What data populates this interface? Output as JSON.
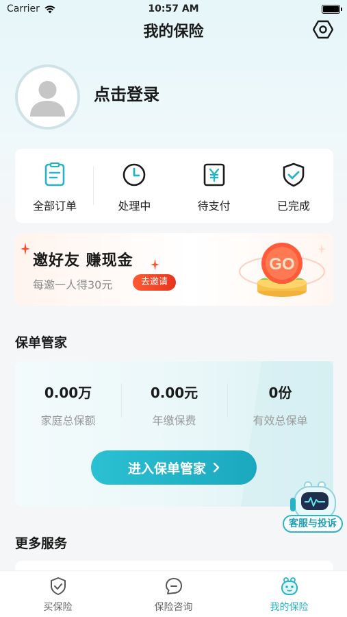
{
  "status_bar": {
    "carrier": "Carrier",
    "time": "10:57 AM"
  },
  "header": {
    "title": "我的保险"
  },
  "profile": {
    "login_text": "点击登录"
  },
  "orders": [
    {
      "label": "全部订单",
      "icon": "order-list-icon"
    },
    {
      "label": "处理中",
      "icon": "clock-icon"
    },
    {
      "label": "待支付",
      "icon": "yuan-payment-icon"
    },
    {
      "label": "已完成",
      "icon": "shield-check-icon"
    }
  ],
  "invite": {
    "title": "邀好友  赚现金",
    "subtitle": "每邀一人得30元",
    "button": "去邀请",
    "coin_text": "GO"
  },
  "policy_section": {
    "title": "保单管家",
    "stats": [
      {
        "value": "0.00万",
        "caption": "家庭总保额"
      },
      {
        "value": "0.00元",
        "caption": "年缴保费"
      },
      {
        "value": "0份",
        "caption": "有效总保单"
      }
    ],
    "enter_button": "进入保单管家"
  },
  "more_section": {
    "title": "更多服务"
  },
  "service": {
    "badge": "客服与投诉"
  },
  "tabbar": [
    {
      "label": "买保险",
      "icon": "shield-check-icon",
      "active": false
    },
    {
      "label": "保险咨询",
      "icon": "chat-icon",
      "active": false
    },
    {
      "label": "我的保险",
      "icon": "mascot-face-icon",
      "active": true
    }
  ],
  "colors": {
    "accent": "#26b3c6",
    "invite_button": "#e8341c",
    "background": "#f5f6f8"
  }
}
